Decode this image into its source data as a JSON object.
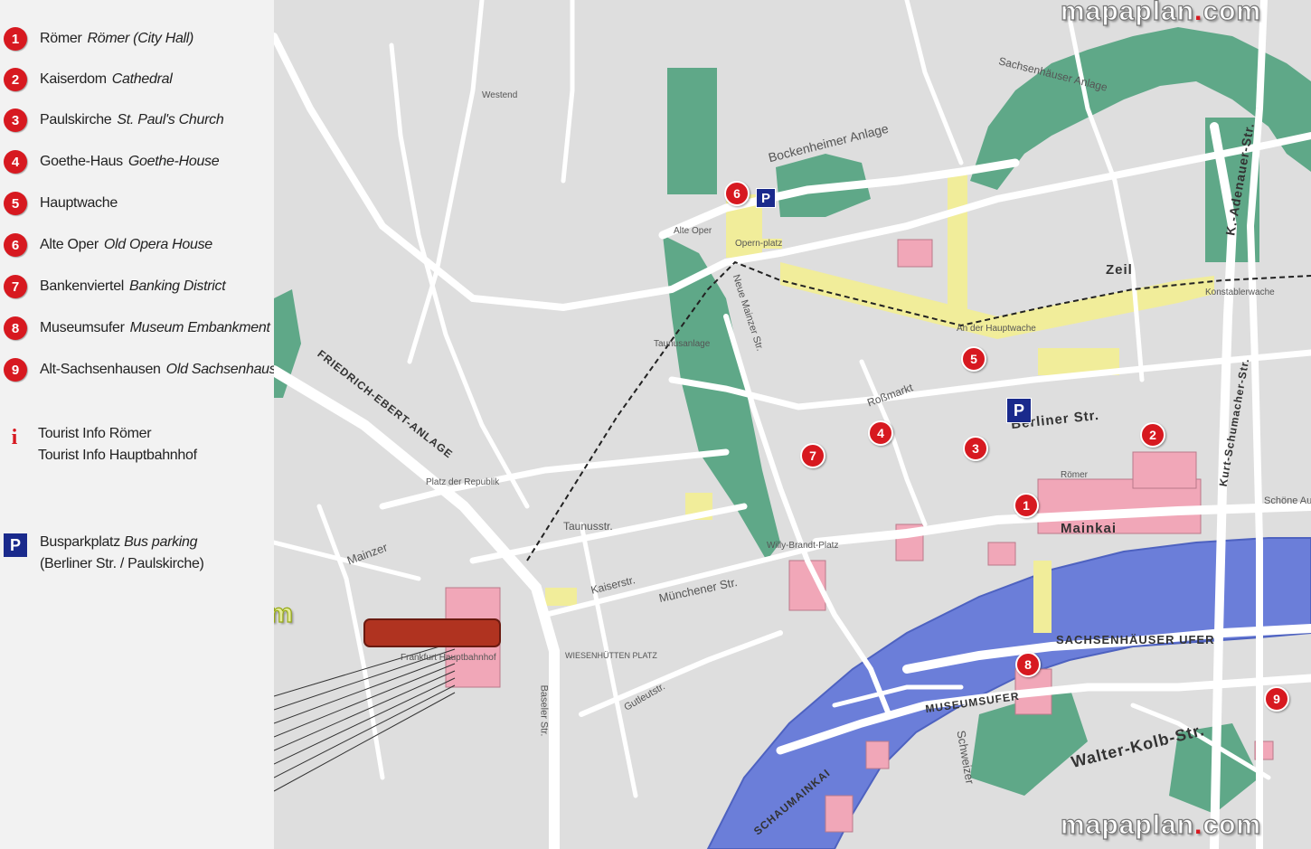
{
  "legend": {
    "items": [
      {
        "num": "1",
        "name": "Römer",
        "translation": "Römer (City Hall)"
      },
      {
        "num": "2",
        "name": "Kaiserdom",
        "translation": "Cathedral"
      },
      {
        "num": "3",
        "name": "Paulskirche",
        "translation": "St. Paul's Church"
      },
      {
        "num": "4",
        "name": "Goethe-Haus",
        "translation": "Goethe-House"
      },
      {
        "num": "5",
        "name": "Hauptwache",
        "translation": ""
      },
      {
        "num": "6",
        "name": "Alte Oper",
        "translation": "Old Opera House"
      },
      {
        "num": "7",
        "name": "Bankenviertel",
        "translation": "Banking District"
      },
      {
        "num": "8",
        "name": "Museumsufer",
        "translation": "Museum Embankment"
      },
      {
        "num": "9",
        "name": "Alt-Sachsenhausen",
        "translation": "Old Sachsenhausen"
      }
    ],
    "tourist_info": {
      "icon": "i",
      "line1": "Tourist Info Römer",
      "line2": "Tourist Info Hauptbahnhof"
    },
    "bus_parking": {
      "icon": "P",
      "line1_name": "Busparkplatz",
      "line1_translation": "Bus parking",
      "line2": "(Berliner Str. / Paulskirche)"
    }
  },
  "watermark": {
    "text": "mapaplan",
    "dot": ".",
    "tld": "com"
  },
  "streets": {
    "zeil": "Zeil",
    "berliner": "Berliner Str.",
    "mainkai": "Mainkai",
    "sachsenhaeuser_ufer": "SACHSENHÄUSER UFER",
    "museumsufer": "MUSEUMSUFER",
    "walter_kolb": "Walter-Kolb-Str.",
    "schaumainkai": "SCHAUMAINKAI",
    "friedrich_ebert": "FRIEDRICH-EBERT-ANLAGE",
    "mainzer": "Mainzer",
    "taunus": "Taunusstr.",
    "kaiser": "Kaiserstr.",
    "muenchener": "Münchener Str.",
    "kurt_schumacher": "Kurt-Schumacher-Str.",
    "konrad_adenauer": "K.-Adenauer-Str.",
    "bockenheimer": "Bockenheimer Anlage",
    "sachsenhaeuser_anlage": "Sachsenhäuser Anlage",
    "baseler": "Baseler Str.",
    "neue_mainzer": "Neue Mainzer Str.",
    "rossmarkt": "Roßmarkt",
    "gutleut": "Gutleutstr.",
    "schweizer": "Schweizer",
    "schoene_aussicht": "Schöne Aussicht"
  },
  "places": {
    "opernplatz": "Opern-platz",
    "alte_oper": "Alte Oper",
    "hauptbahnhof": "Frankfurt Hauptbahnhof",
    "westend": "Westend",
    "hauptwache": "An der Hauptwache",
    "konstablerwache": "Konstablerwache",
    "willy_brandt": "Willy-Brandt-Platz",
    "roemer": "Römer",
    "platz_der_republik": "Platz der Republik",
    "wiesenhuetten": "WIESENHÜTTEN PLATZ",
    "taunusanlage": "Taunusanlage"
  },
  "markers": [
    "1",
    "2",
    "3",
    "4",
    "5",
    "6",
    "7",
    "8",
    "9"
  ],
  "parking_icon": "P",
  "colors": {
    "marker": "#d71920",
    "parking": "#1a2a8c",
    "river": "#6b7ed9",
    "park": "#5fa888",
    "building": "#f1a7b8"
  }
}
